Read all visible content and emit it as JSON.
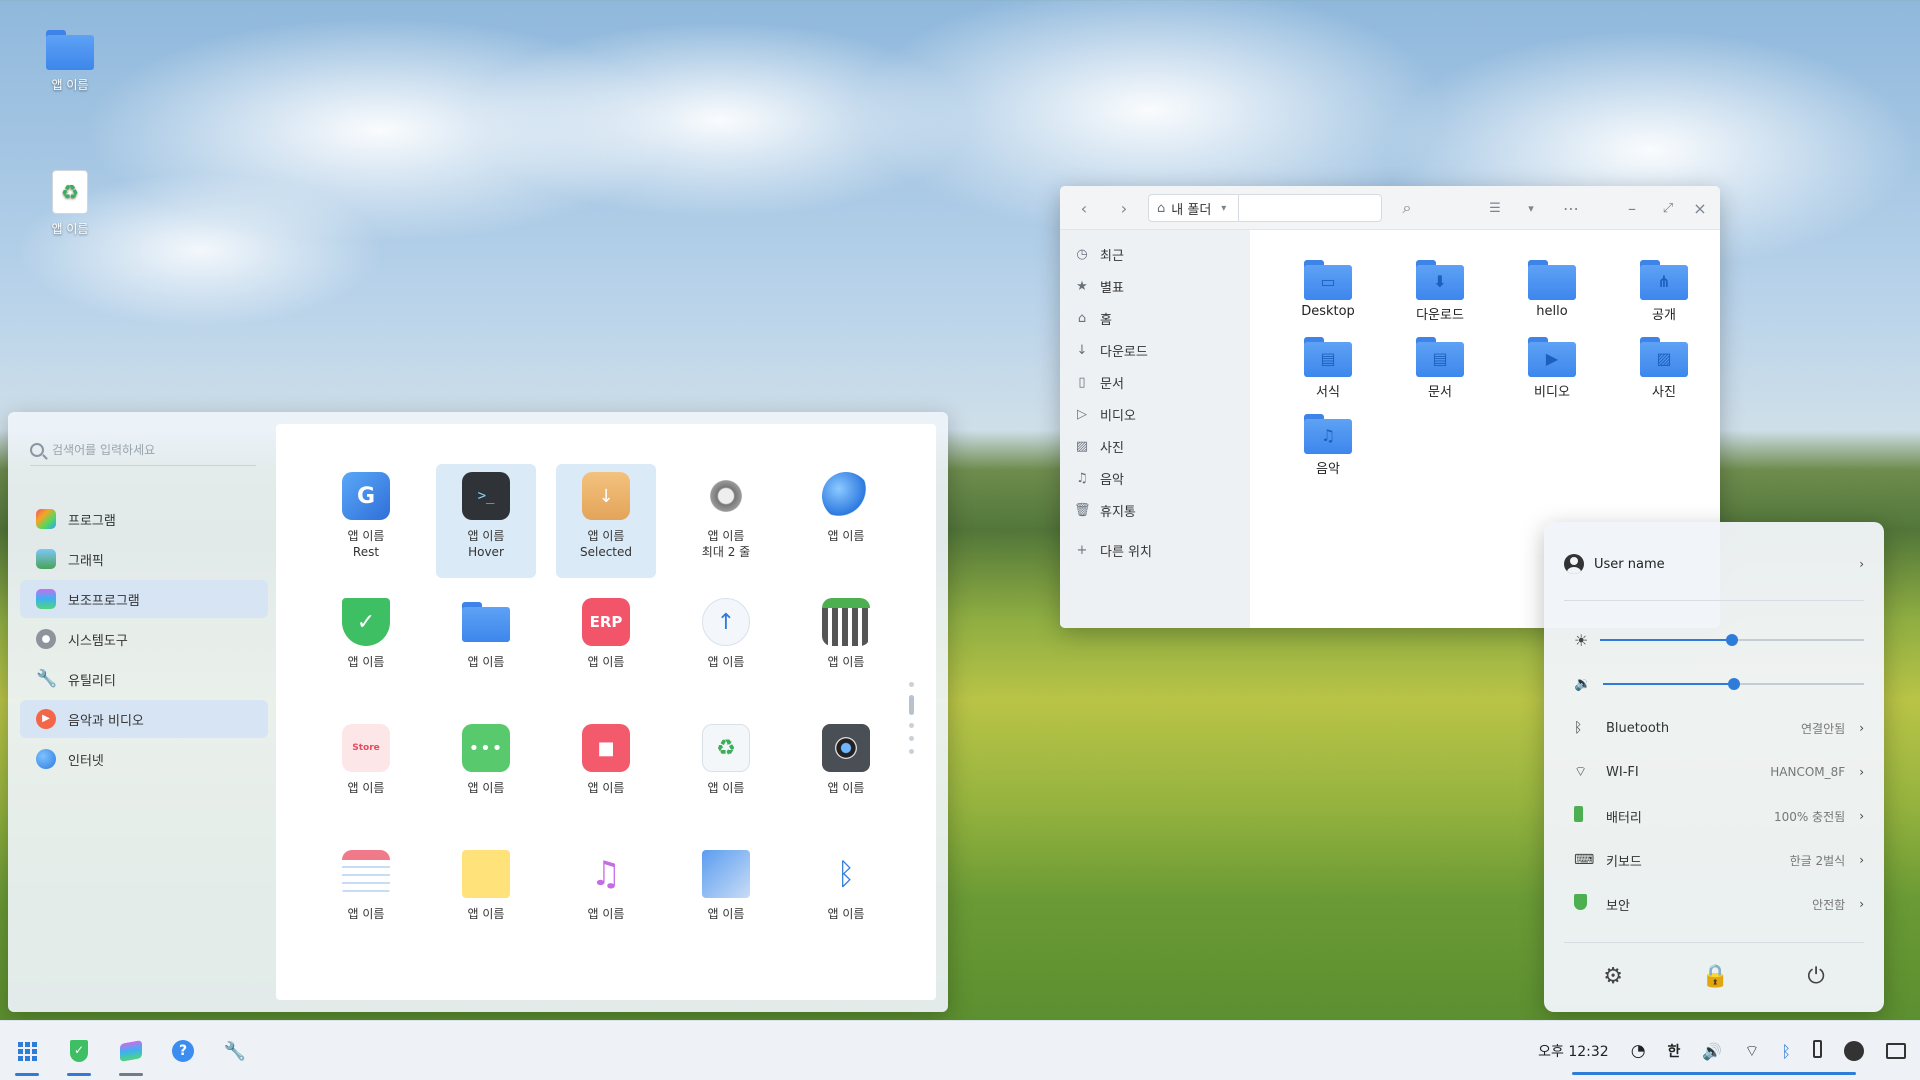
{
  "desktop": {
    "icons": [
      {
        "label": "앱 이름",
        "icon": "folder-icon"
      },
      {
        "label": "앱 이름",
        "icon": "recycle-bin-icon"
      }
    ]
  },
  "launcher": {
    "search_placeholder": "검색어를 입력하세요",
    "categories": [
      {
        "label": "프로그램",
        "icon": "programs-icon",
        "active": false
      },
      {
        "label": "그래픽",
        "icon": "graphics-icon",
        "active": false
      },
      {
        "label": "보조프로그램",
        "icon": "accessories-icon",
        "active": true
      },
      {
        "label": "시스템도구",
        "icon": "system-tools-icon",
        "active": false
      },
      {
        "label": "유틸리티",
        "icon": "utilities-icon",
        "active": false
      },
      {
        "label": "음악과 비디오",
        "icon": "music-video-icon",
        "active": true
      },
      {
        "label": "인터넷",
        "icon": "internet-icon",
        "active": false
      }
    ],
    "apps": [
      {
        "label": "앱 이름",
        "sub": "Rest",
        "icon": "gooroom-icon"
      },
      {
        "label": "앱 이름",
        "sub": "Hover",
        "icon": "terminal-icon"
      },
      {
        "label": "앱 이름",
        "sub": "Selected",
        "icon": "package-icon"
      },
      {
        "label": "앱 이름",
        "sub": "최대 2 줄",
        "icon": "settings-gear-icon"
      },
      {
        "label": "앱 이름",
        "sub": "",
        "icon": "planet-icon"
      },
      {
        "label": "앱 이름",
        "sub": "",
        "icon": "security-shield-icon"
      },
      {
        "label": "앱 이름",
        "sub": "",
        "icon": "folder-icon"
      },
      {
        "label": "앱 이름",
        "sub": "",
        "icon": "erp-icon",
        "text": "ERP"
      },
      {
        "label": "앱 이름",
        "sub": "",
        "icon": "cloud-upload-icon"
      },
      {
        "label": "앱 이름",
        "sub": "",
        "icon": "calculator-icon"
      },
      {
        "label": "앱 이름",
        "sub": "",
        "icon": "store-icon",
        "text": "Store"
      },
      {
        "label": "앱 이름",
        "sub": "",
        "icon": "chat-icon"
      },
      {
        "label": "앱 이름",
        "sub": "",
        "icon": "video-call-icon"
      },
      {
        "label": "앱 이름",
        "sub": "",
        "icon": "recycle-icon"
      },
      {
        "label": "앱 이름",
        "sub": "",
        "icon": "camera-icon"
      },
      {
        "label": "앱 이름",
        "sub": "",
        "icon": "calendar-icon"
      },
      {
        "label": "앱 이름",
        "sub": "",
        "icon": "sticky-note-icon"
      },
      {
        "label": "앱 이름",
        "sub": "",
        "icon": "music-note-icon"
      },
      {
        "label": "앱 이름",
        "sub": "",
        "icon": "card-icon"
      },
      {
        "label": "앱 이름",
        "sub": "",
        "icon": "bluetooth-icon"
      }
    ]
  },
  "file_manager": {
    "path": "내 폴더",
    "sidebar": [
      {
        "label": "최근",
        "icon": "clock-icon"
      },
      {
        "label": "별표",
        "icon": "star-icon"
      },
      {
        "label": "홈",
        "icon": "home-icon"
      },
      {
        "label": "다운로드",
        "icon": "download-icon"
      },
      {
        "label": "문서",
        "icon": "document-icon"
      },
      {
        "label": "비디오",
        "icon": "video-icon"
      },
      {
        "label": "사진",
        "icon": "image-icon"
      },
      {
        "label": "음악",
        "icon": "music-icon"
      },
      {
        "label": "휴지통",
        "icon": "trash-icon"
      },
      {
        "label": "다른 위치",
        "icon": "plus-icon"
      }
    ],
    "folders": [
      {
        "label": "Desktop",
        "icon": "desktop-folder-icon"
      },
      {
        "label": "다운로드",
        "icon": "download-folder-icon"
      },
      {
        "label": "hello",
        "icon": "folder-icon"
      },
      {
        "label": "공개",
        "icon": "share-folder-icon"
      },
      {
        "label": "서식",
        "icon": "template-folder-icon"
      },
      {
        "label": "문서",
        "icon": "document-folder-icon"
      },
      {
        "label": "비디오",
        "icon": "video-folder-icon"
      },
      {
        "label": "사진",
        "icon": "image-folder-icon"
      },
      {
        "label": "음악",
        "icon": "music-folder-icon"
      }
    ]
  },
  "quick_settings": {
    "user": "User name",
    "brightness": 0.5,
    "volume": 0.5,
    "rows": [
      {
        "label": "Bluetooth",
        "value": "연결안됨",
        "icon": "bluetooth-icon"
      },
      {
        "label": "WI-FI",
        "value": "HANCOM_8F",
        "icon": "wifi-icon"
      },
      {
        "label": "배터리",
        "value": "100% 충전됨",
        "icon": "battery-icon"
      },
      {
        "label": "키보드",
        "value": "한글 2벌식",
        "icon": "keyboard-icon"
      },
      {
        "label": "보안",
        "value": "안전함",
        "icon": "shield-icon"
      }
    ]
  },
  "taskbar": {
    "time": "오후 12:32",
    "ime": "한"
  },
  "colors": {
    "accent": "#2f7cd8",
    "folder": "#4a90ee",
    "selection": "#dbeaf7"
  }
}
